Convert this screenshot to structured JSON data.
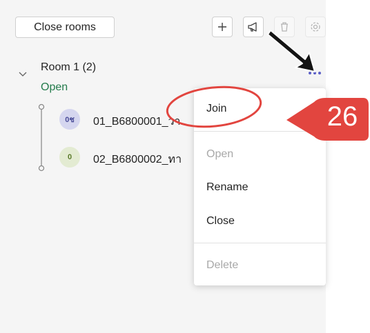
{
  "toolbar": {
    "close_rooms_label": "Close rooms",
    "icons": [
      "plus-icon",
      "announcement-icon",
      "trash-icon",
      "settings-icon"
    ]
  },
  "room": {
    "name": "Room 1",
    "count": "(2)",
    "status": "Open",
    "status_color": "#237b4b",
    "participants": [
      {
        "initials": "0ช",
        "name": "01_B6800001_วา"
      },
      {
        "initials": "0",
        "name": "02_B6800002_ทา"
      }
    ]
  },
  "menu": {
    "items": [
      {
        "label": "Join",
        "disabled": false
      },
      {
        "label": "Open",
        "disabled": true
      },
      {
        "label": "Rename",
        "disabled": false
      },
      {
        "label": "Close",
        "disabled": false
      },
      {
        "label": "Delete",
        "disabled": true
      }
    ]
  },
  "annotation": {
    "step_number": "26",
    "accent_color": "#e2453f",
    "more_icon_color": "#5b5fc7"
  }
}
